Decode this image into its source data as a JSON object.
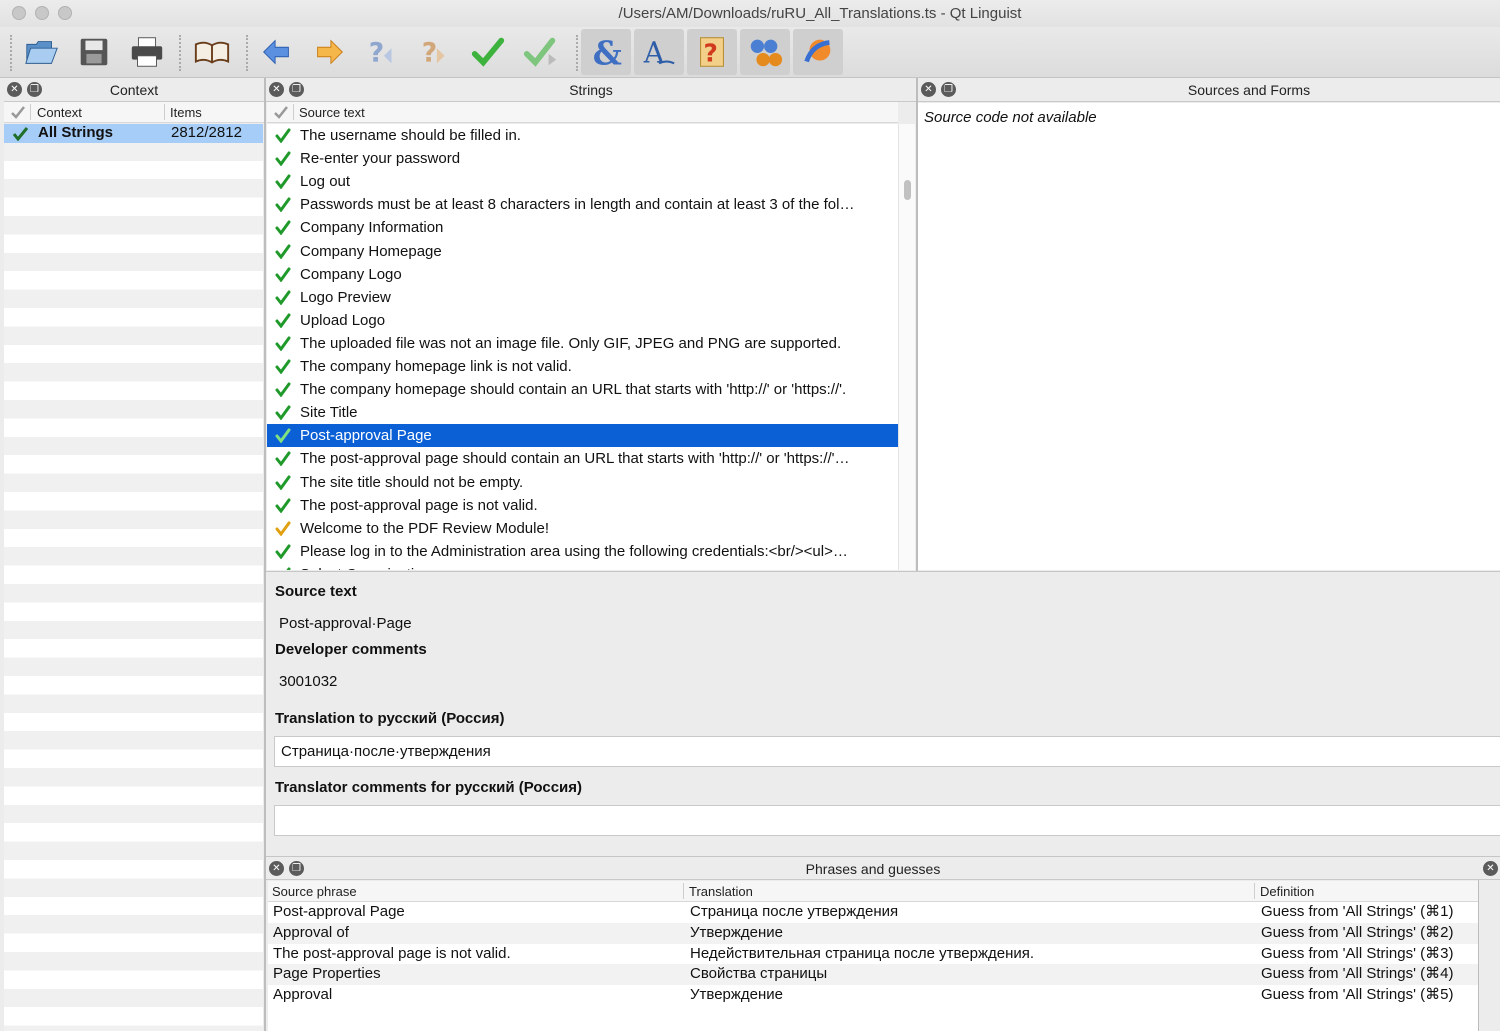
{
  "window": {
    "title": "/Users/AM/Downloads/ruRU_All_Translations.ts - Qt Linguist"
  },
  "toolbar": {
    "buttons": [
      {
        "name": "open-icon"
      },
      {
        "name": "save-icon"
      },
      {
        "name": "print-icon"
      },
      {
        "name": "phrasebook-icon"
      },
      {
        "name": "prev-unfinished-icon"
      },
      {
        "name": "next-unfinished-icon"
      },
      {
        "name": "prev-item-icon"
      },
      {
        "name": "next-item-icon"
      },
      {
        "name": "done-icon"
      },
      {
        "name": "done-next-icon"
      },
      {
        "name": "accelerators-icon"
      },
      {
        "name": "punctuation-icon"
      },
      {
        "name": "phrase-matches-icon"
      },
      {
        "name": "placeholders-icon"
      },
      {
        "name": "surrounding-whitespace-icon"
      }
    ]
  },
  "context_panel": {
    "title": "Context",
    "col_context": "Context",
    "col_items": "Items",
    "rows": [
      {
        "name": "All Strings",
        "items": "2812/2812"
      }
    ]
  },
  "strings_panel": {
    "title": "Strings",
    "col_source": "Source text",
    "rows": [
      {
        "text": "The username should be filled in.",
        "state": "done"
      },
      {
        "text": "Re-enter your password",
        "state": "done"
      },
      {
        "text": "Log out",
        "state": "done"
      },
      {
        "text": "Passwords must be at least 8 characters in length and contain at least 3 of the fol…",
        "state": "done"
      },
      {
        "text": "Company Information",
        "state": "done"
      },
      {
        "text": "Company Homepage",
        "state": "done"
      },
      {
        "text": "Company Logo",
        "state": "done"
      },
      {
        "text": "Logo Preview",
        "state": "done"
      },
      {
        "text": "Upload Logo",
        "state": "done"
      },
      {
        "text": "The uploaded file was not an image file. Only GIF, JPEG and PNG are supported.",
        "state": "done"
      },
      {
        "text": "The company homepage link is not valid.",
        "state": "done"
      },
      {
        "text": "The company homepage should contain an URL that starts with 'http://' or 'https://'.",
        "state": "done"
      },
      {
        "text": "Site Title",
        "state": "done"
      },
      {
        "text": "Post-approval Page",
        "state": "done",
        "selected": true
      },
      {
        "text": "The post-approval page should contain an URL that starts with 'http://' or 'https://'…",
        "state": "done"
      },
      {
        "text": "The site title should not be empty.",
        "state": "done"
      },
      {
        "text": "The post-approval page is not valid.",
        "state": "done"
      },
      {
        "text": "Welcome to the PDF Review Module!",
        "state": "warning"
      },
      {
        "text": "Please log in to the Administration area using the following credentials:<br/><ul>…",
        "state": "done"
      },
      {
        "text": "Select Organization",
        "state": "done"
      }
    ]
  },
  "sources_panel": {
    "title": "Sources and Forms",
    "message": "Source code not available"
  },
  "editor": {
    "source_label": "Source text",
    "source_value": "Post-approval·Page",
    "dev_comments_label": "Developer comments",
    "dev_comments_value": "3001032",
    "translation_label": "Translation to русский (Россия)",
    "translation_value": "Страница·после·утверждения",
    "translator_comments_label": "Translator comments for русский (Россия)",
    "translator_comments_value": ""
  },
  "phrases_panel": {
    "title": "Phrases and guesses",
    "col_source": "Source phrase",
    "col_translation": "Translation",
    "col_definition": "Definition",
    "rows": [
      {
        "source": "Post-approval Page",
        "translation": "Страница после утверждения",
        "definition": "Guess from 'All Strings' (⌘1)"
      },
      {
        "source": "Approval of",
        "translation": "Утверждение",
        "definition": "Guess from 'All Strings' (⌘2)"
      },
      {
        "source": "The post-approval page is not valid.",
        "translation": "Недействительная страница после утверждения.",
        "definition": "Guess from 'All Strings' (⌘3)"
      },
      {
        "source": "Page Properties",
        "translation": "Свойства страницы",
        "definition": "Guess from 'All Strings' (⌘4)"
      },
      {
        "source": "Approval",
        "translation": "Утверждение",
        "definition": "Guess from 'All Strings' (⌘5)"
      }
    ]
  },
  "colors": {
    "selection": "#0b60d6",
    "done": "#1f9a2a",
    "warning": "#e0a010",
    "context_selection": "#a6cdf7"
  }
}
